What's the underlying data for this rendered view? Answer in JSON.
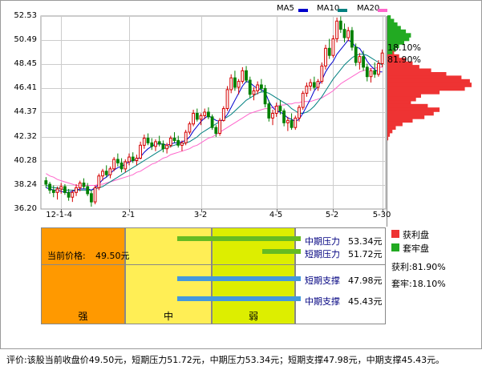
{
  "legend": {
    "items": [
      {
        "label": "MA5",
        "color": "#0000cc"
      },
      {
        "label": "MA10",
        "color": "#008080"
      },
      {
        "label": "MA20",
        "color": "#ff66cc"
      }
    ]
  },
  "colors": {
    "up": "#d40000",
    "down": "#008000",
    "profit": "#ee3333",
    "trapped": "#22aa22",
    "grid": "#cccccc"
  },
  "chart_data": [
    {
      "type": "candlestick",
      "y_ticks": [
        "52.53",
        "50.49",
        "48.45",
        "46.41",
        "44.37",
        "42.32",
        "40.28",
        "38.24",
        "36.20"
      ],
      "ylim": [
        36.2,
        52.53
      ],
      "x_ticks": [
        "12-1-4",
        "2-1",
        "3-2",
        "4-5",
        "5-2",
        "5-30"
      ],
      "grid": true,
      "candles": [
        [
          38.6,
          38.9,
          38.0,
          38.3
        ],
        [
          38.3,
          38.5,
          37.5,
          37.8
        ],
        [
          37.8,
          38.2,
          37.2,
          37.6
        ],
        [
          37.6,
          38.1,
          37.0,
          37.9
        ],
        [
          37.9,
          38.4,
          37.5,
          38.1
        ],
        [
          38.1,
          38.3,
          37.4,
          37.6
        ],
        [
          37.6,
          37.9,
          36.9,
          37.2
        ],
        [
          37.2,
          37.8,
          36.8,
          37.6
        ],
        [
          37.6,
          38.3,
          37.3,
          38.0
        ],
        [
          38.0,
          38.6,
          37.7,
          38.4
        ],
        [
          38.4,
          38.8,
          37.9,
          38.1
        ],
        [
          38.1,
          38.4,
          37.3,
          37.5
        ],
        [
          37.5,
          37.8,
          36.4,
          36.8
        ],
        [
          36.8,
          38.2,
          36.6,
          38.0
        ],
        [
          38.0,
          39.2,
          37.8,
          39.0
        ],
        [
          39.0,
          39.6,
          38.6,
          39.4
        ],
        [
          39.4,
          39.9,
          38.9,
          39.1
        ],
        [
          39.1,
          39.8,
          38.8,
          39.6
        ],
        [
          39.6,
          40.6,
          39.4,
          40.4
        ],
        [
          40.4,
          40.9,
          39.8,
          40.1
        ],
        [
          40.1,
          40.5,
          39.3,
          39.6
        ],
        [
          39.6,
          40.4,
          39.3,
          40.2
        ],
        [
          40.2,
          40.9,
          39.9,
          40.6
        ],
        [
          40.6,
          41.0,
          40.1,
          40.3
        ],
        [
          40.3,
          40.8,
          39.9,
          40.5
        ],
        [
          40.5,
          41.9,
          40.4,
          41.6
        ],
        [
          41.6,
          42.5,
          41.3,
          42.2
        ],
        [
          42.2,
          42.6,
          41.6,
          41.8
        ],
        [
          41.8,
          42.2,
          41.2,
          41.5
        ],
        [
          41.5,
          42.1,
          41.1,
          41.9
        ],
        [
          41.9,
          42.4,
          41.5,
          41.7
        ],
        [
          41.7,
          42.0,
          41.0,
          41.3
        ],
        [
          41.3,
          41.8,
          40.9,
          41.6
        ],
        [
          41.6,
          42.4,
          41.4,
          42.2
        ],
        [
          42.2,
          42.7,
          41.8,
          42.0
        ],
        [
          42.0,
          42.4,
          41.4,
          41.6
        ],
        [
          41.6,
          42.0,
          41.1,
          41.8
        ],
        [
          41.8,
          42.9,
          41.6,
          42.7
        ],
        [
          42.7,
          43.6,
          42.5,
          43.4
        ],
        [
          43.4,
          44.6,
          43.2,
          44.3
        ],
        [
          44.3,
          44.7,
          43.6,
          43.8
        ],
        [
          43.8,
          44.3,
          43.3,
          44.1
        ],
        [
          44.1,
          44.7,
          43.8,
          44.4
        ],
        [
          44.4,
          44.8,
          43.8,
          44.0
        ],
        [
          44.0,
          44.2,
          42.9,
          43.1
        ],
        [
          43.1,
          43.3,
          42.3,
          42.6
        ],
        [
          42.6,
          43.9,
          42.4,
          43.7
        ],
        [
          43.7,
          44.9,
          43.6,
          44.7
        ],
        [
          44.7,
          46.6,
          44.5,
          46.3
        ],
        [
          46.3,
          47.6,
          46.0,
          47.3
        ],
        [
          47.3,
          47.9,
          46.2,
          46.5
        ],
        [
          46.5,
          47.2,
          45.9,
          47.0
        ],
        [
          47.0,
          48.2,
          46.8,
          47.9
        ],
        [
          47.9,
          48.3,
          46.9,
          47.1
        ],
        [
          47.1,
          47.4,
          45.6,
          45.9
        ],
        [
          45.9,
          46.5,
          45.4,
          46.2
        ],
        [
          46.2,
          47.0,
          45.9,
          46.7
        ],
        [
          46.7,
          47.2,
          46.1,
          46.4
        ],
        [
          46.4,
          46.7,
          44.8,
          45.1
        ],
        [
          45.1,
          45.4,
          43.6,
          43.9
        ],
        [
          43.9,
          44.6,
          43.3,
          44.3
        ],
        [
          44.3,
          45.2,
          44.0,
          44.9
        ],
        [
          44.9,
          45.4,
          44.2,
          44.5
        ],
        [
          44.5,
          44.7,
          43.2,
          43.5
        ],
        [
          43.5,
          44.0,
          42.8,
          43.7
        ],
        [
          43.7,
          44.3,
          42.9,
          43.1
        ],
        [
          43.1,
          44.1,
          42.9,
          43.9
        ],
        [
          43.9,
          45.0,
          43.6,
          44.8
        ],
        [
          44.8,
          46.2,
          44.6,
          46.0
        ],
        [
          46.0,
          46.9,
          45.7,
          46.6
        ],
        [
          46.6,
          47.2,
          46.2,
          46.9
        ],
        [
          46.9,
          47.4,
          46.3,
          46.5
        ],
        [
          46.5,
          47.2,
          46.2,
          47.0
        ],
        [
          47.0,
          48.6,
          46.8,
          48.3
        ],
        [
          48.3,
          50.1,
          48.0,
          49.8
        ],
        [
          49.8,
          50.6,
          48.9,
          49.2
        ],
        [
          49.2,
          50.9,
          49.0,
          50.6
        ],
        [
          50.6,
          52.4,
          50.3,
          52.1
        ],
        [
          52.1,
          52.5,
          51.1,
          51.4
        ],
        [
          51.4,
          51.9,
          50.3,
          50.7
        ],
        [
          50.7,
          51.6,
          50.4,
          51.3
        ],
        [
          51.3,
          51.6,
          49.6,
          49.9
        ],
        [
          49.9,
          50.2,
          48.3,
          48.6
        ],
        [
          48.6,
          49.4,
          48.0,
          49.1
        ],
        [
          49.1,
          49.6,
          47.9,
          48.2
        ],
        [
          48.2,
          48.5,
          47.0,
          47.4
        ],
        [
          47.4,
          48.1,
          46.9,
          47.9
        ],
        [
          47.9,
          48.6,
          47.3,
          47.6
        ],
        [
          47.6,
          48.8,
          47.4,
          48.5
        ],
        [
          48.5,
          49.7,
          48.2,
          49.4
        ]
      ],
      "ma5": [
        38.0,
        37.9,
        37.8,
        37.8,
        37.7,
        37.6,
        37.6,
        37.7,
        37.8,
        37.9,
        37.9,
        37.9,
        37.8,
        38.0,
        38.3,
        38.7,
        38.9,
        39.2,
        39.5,
        39.7,
        39.8,
        40.0,
        40.2,
        40.3,
        40.4,
        40.6,
        41.0,
        41.3,
        41.5,
        41.7,
        41.7,
        41.7,
        41.6,
        41.7,
        41.8,
        41.8,
        41.9,
        42.0,
        42.3,
        42.8,
        43.2,
        43.6,
        43.9,
        44.1,
        43.9,
        43.7,
        43.6,
        43.8,
        44.2,
        44.8,
        45.4,
        46.0,
        46.6,
        47.0,
        46.9,
        46.6,
        46.4,
        46.3,
        46.1,
        45.3,
        44.8,
        44.5,
        44.4,
        44.2,
        43.9,
        43.8,
        43.6,
        43.8,
        44.3,
        44.9,
        45.5,
        46.2,
        46.6,
        47.1,
        47.8,
        48.3,
        48.7,
        49.3,
        49.7,
        50.1,
        50.5,
        50.3,
        49.9,
        49.8,
        49.3,
        48.7,
        48.3,
        48.0,
        47.8,
        47.8
      ],
      "ma10": [
        38.2,
        38.1,
        38.0,
        38.0,
        37.9,
        37.8,
        37.8,
        37.8,
        37.8,
        37.8,
        37.8,
        37.8,
        37.8,
        37.9,
        38.0,
        38.1,
        38.3,
        38.5,
        38.7,
        38.9,
        39.1,
        39.3,
        39.5,
        39.7,
        39.9,
        40.1,
        40.3,
        40.5,
        40.7,
        40.9,
        41.1,
        41.3,
        41.4,
        41.5,
        41.6,
        41.7,
        41.7,
        41.8,
        41.9,
        42.1,
        42.3,
        42.6,
        42.8,
        43.0,
        43.2,
        43.4,
        43.6,
        43.8,
        44.0,
        44.2,
        44.5,
        44.8,
        45.1,
        45.4,
        45.6,
        45.8,
        46.0,
        46.1,
        46.1,
        46.0,
        45.8,
        45.6,
        45.4,
        45.2,
        45.0,
        44.7,
        44.5,
        44.3,
        44.3,
        44.4,
        44.6,
        44.9,
        45.3,
        45.7,
        46.2,
        46.7,
        47.2,
        47.6,
        48.0,
        48.4,
        48.7,
        49.0,
        49.2,
        49.3,
        49.3,
        49.2,
        49.0,
        48.8,
        48.6,
        48.4
      ],
      "ma20": [
        39.2,
        39.0,
        38.9,
        38.7,
        38.6,
        38.5,
        38.4,
        38.3,
        38.2,
        38.2,
        38.2,
        38.2,
        38.2,
        38.2,
        38.3,
        38.3,
        38.4,
        38.5,
        38.6,
        38.7,
        38.8,
        38.9,
        39.0,
        39.1,
        39.3,
        39.4,
        39.6,
        39.8,
        40.0,
        40.1,
        40.3,
        40.5,
        40.6,
        40.8,
        40.9,
        41.0,
        41.1,
        41.2,
        41.3,
        41.5,
        41.6,
        41.8,
        42.0,
        42.2,
        42.3,
        42.5,
        42.7,
        42.9,
        43.1,
        43.3,
        43.5,
        43.7,
        43.9,
        44.1,
        44.3,
        44.4,
        44.5,
        44.6,
        44.7,
        44.7,
        44.8,
        44.9,
        45.0,
        45.0,
        45.1,
        45.1,
        45.2,
        45.2,
        45.3,
        45.3,
        45.3,
        45.4,
        45.5,
        45.6,
        45.8,
        46.0,
        46.2,
        46.5,
        46.8,
        47.0,
        47.2,
        47.4,
        47.6,
        47.8,
        47.9,
        48.0,
        48.1,
        48.1,
        48.2,
        48.2
      ]
    },
    {
      "type": "bar",
      "orientation": "horizontal",
      "name": "chip-distribution",
      "ylim": [
        36.2,
        52.53
      ],
      "price_levels": [
        52.4,
        52.1,
        51.8,
        51.5,
        51.2,
        50.9,
        50.6,
        50.3,
        50.0,
        49.7,
        49.4,
        49.1,
        48.8,
        48.5,
        48.2,
        47.9,
        47.6,
        47.3,
        47.0,
        46.7,
        46.4,
        46.1,
        45.8,
        45.5,
        45.2,
        44.9,
        44.6,
        44.3,
        44.0,
        43.7,
        43.4,
        43.1,
        42.8,
        42.5,
        42.2
      ],
      "profit_pct": [
        0,
        0,
        0,
        0,
        0,
        0,
        0,
        0,
        0,
        0,
        8,
        14,
        22,
        30,
        38,
        52,
        70,
        88,
        98,
        100,
        92,
        62,
        40,
        34,
        28,
        48,
        62,
        55,
        44,
        30,
        18,
        10,
        6,
        3,
        1
      ],
      "trapped_pct": [
        4,
        8,
        12,
        16,
        22,
        28,
        26,
        20,
        14,
        10,
        6,
        0,
        0,
        0,
        0,
        0,
        0,
        0,
        0,
        0,
        0,
        0,
        0,
        0,
        0,
        0,
        0,
        0,
        0,
        0,
        0,
        0,
        0,
        0,
        0
      ],
      "labels": {
        "trapped": "18.10%",
        "profit": "81.90%"
      }
    }
  ],
  "zones": {
    "strong": "强",
    "mid": "中",
    "weak": "弱"
  },
  "current_price": {
    "label": "当前价格:",
    "value": "49.50元"
  },
  "levels": [
    {
      "name": "中期压力",
      "value": "53.34元",
      "color": "#66bb22"
    },
    {
      "name": "短期压力",
      "value": "51.72元",
      "color": "#66bb22"
    },
    {
      "name": "短期支撑",
      "value": "47.98元",
      "color": "#4499dd"
    },
    {
      "name": "中期支撑",
      "value": "45.43元",
      "color": "#4499dd"
    }
  ],
  "side_legend": {
    "profit_label": "获利盘",
    "trapped_label": "套牢盘",
    "profit_ratio": "获利:81.90%",
    "trapped_ratio": "套牢:18.10%"
  },
  "footer": "评价:该股当前收盘价49.50元，短期压力51.72元，中期压力53.34元；短期支撑47.98元，中期支撑45.43元。"
}
